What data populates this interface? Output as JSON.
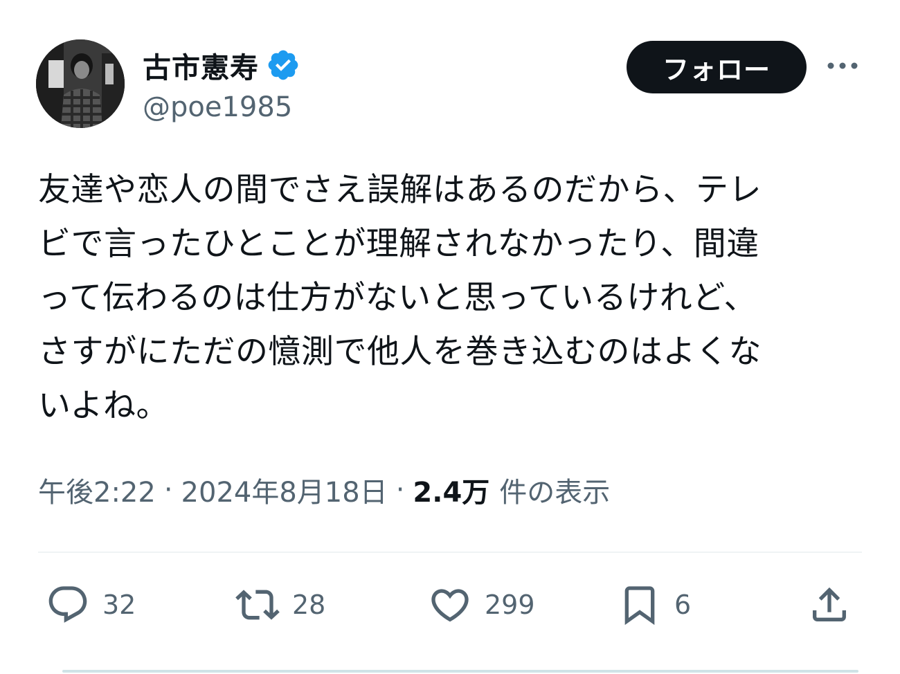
{
  "author": {
    "display_name": "古市憲寿",
    "handle": "@poe1985",
    "verified": true,
    "verified_color": "#1d9bf0"
  },
  "buttons": {
    "follow_label": "フォロー",
    "more_icon": "more-horizontal-icon"
  },
  "tweet": {
    "text": "友達や恋人の間でさえ誤解はあるのだから、テレ\nビで言ったひとことが理解されなかったり、間違\nって伝わるのは仕方がないと思っているけれど、\nさすがにただの憶測で他人を巻き込むのはよくな\nいよね。",
    "time": "午後2:22",
    "date": "2024年8月18日",
    "separator": "·",
    "views_count": "2.4万",
    "views_label": "件の表示"
  },
  "actions": {
    "replies": "32",
    "retweets": "28",
    "likes": "299",
    "bookmarks": "6"
  },
  "colors": {
    "text_primary": "#0f1419",
    "text_secondary": "#536471",
    "divider": "#eff3f4"
  }
}
